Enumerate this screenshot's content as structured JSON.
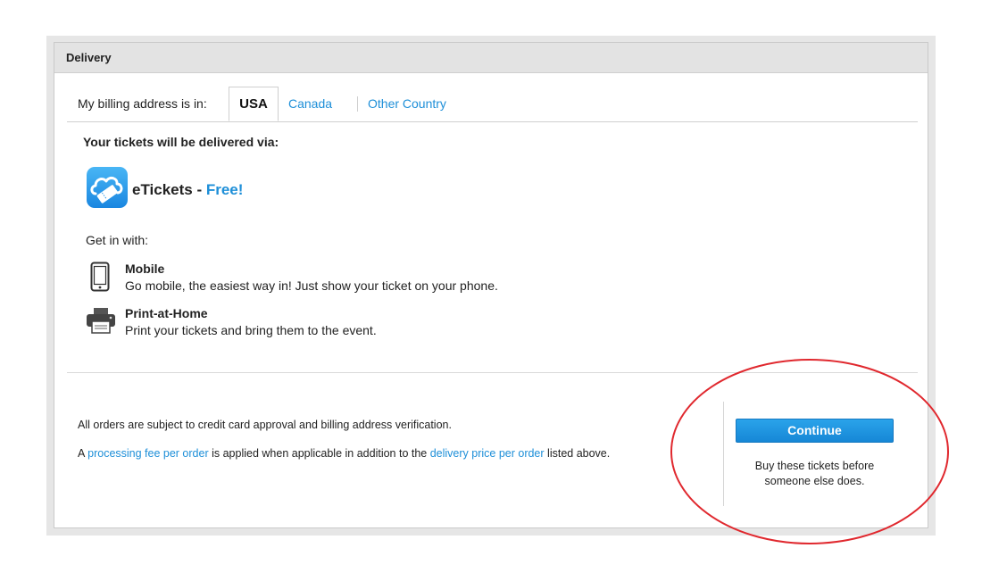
{
  "panel": {
    "title": "Delivery"
  },
  "billing": {
    "label": "My billing address is in:",
    "tabs": [
      {
        "label": "USA",
        "selected": true
      },
      {
        "label": "Canada",
        "selected": false
      },
      {
        "label": "Other Country",
        "selected": false
      }
    ]
  },
  "delivery": {
    "heading": "Your tickets will be delivered via:",
    "method_name": "eTickets - ",
    "method_price": "Free!",
    "icon": "eticket-cloud-icon"
  },
  "entry": {
    "heading": "Get in with:",
    "options": [
      {
        "title": "Mobile",
        "description": "Go mobile, the easiest way in! Just show your ticket on your phone.",
        "icon": "mobile-phone-icon"
      },
      {
        "title": "Print-at-Home",
        "description": "Print your tickets and bring them to the event.",
        "icon": "printer-icon"
      }
    ]
  },
  "notes": {
    "approval": "All orders are subject to credit card approval and billing address verification.",
    "fee_prefix": "A ",
    "fee_link": "processing fee per order",
    "fee_middle": " is applied when applicable in addition to the ",
    "delivery_link": "delivery price per order",
    "fee_suffix": " listed above."
  },
  "action": {
    "continue_label": "Continue",
    "hint": "Buy these tickets before someone else does."
  },
  "colors": {
    "link": "#1e8fd8",
    "button": "#1e95e0",
    "annotation": "#e0282e"
  }
}
